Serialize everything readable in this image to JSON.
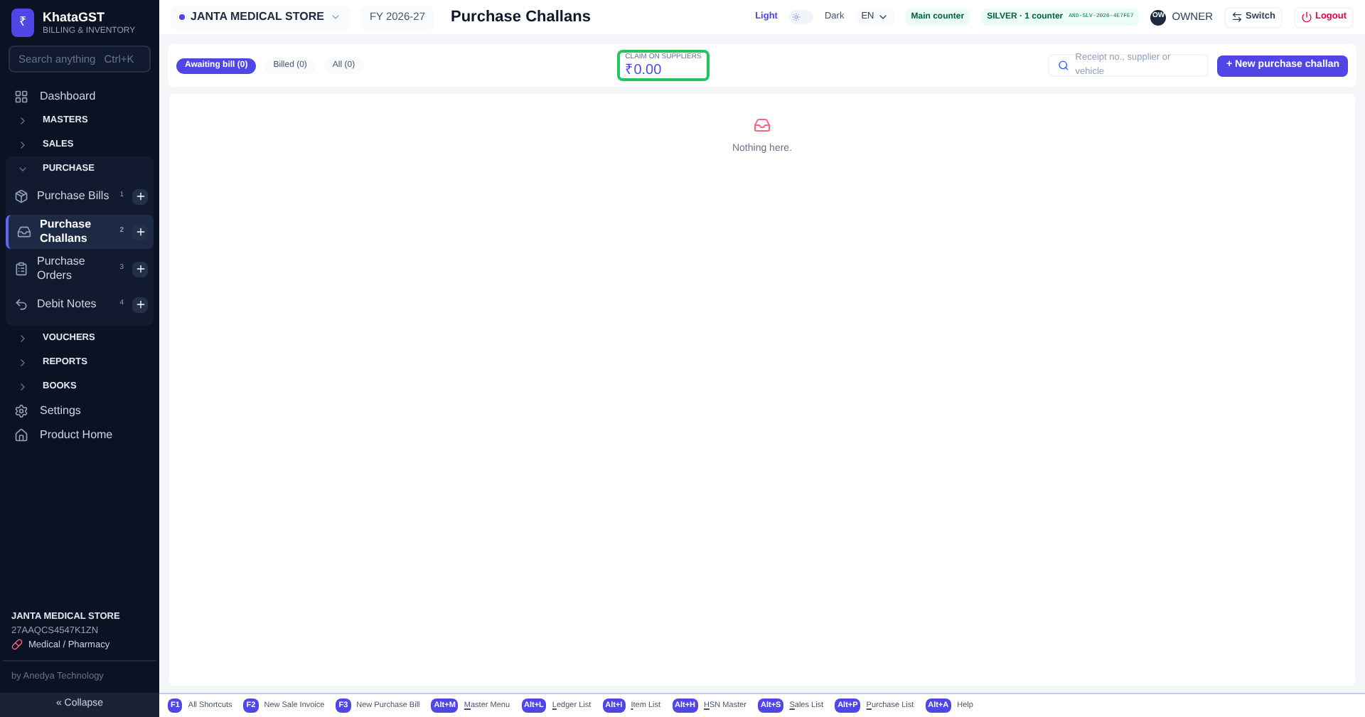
{
  "brand": {
    "logo": "₹",
    "name": "KhataGST",
    "tagline": "BILLING & INVENTORY"
  },
  "search": {
    "placeholder": "Search anything",
    "shortcut": "Ctrl+K"
  },
  "nav": [
    {
      "kind": "link",
      "label": "Dashboard",
      "selected": false
    },
    {
      "kind": "section",
      "label": "MASTERS",
      "expanded": false
    },
    {
      "kind": "section",
      "label": "SALES",
      "expanded": false
    },
    {
      "kind": "section",
      "label": "PURCHASE",
      "expanded": true,
      "children": [
        {
          "label": "Purchase Bills",
          "count": "1",
          "selected": false
        },
        {
          "label": "Purchase Challans",
          "count": "2",
          "selected": true
        },
        {
          "label": "Purchase Orders",
          "count": "3",
          "selected": false
        },
        {
          "label": "Debit Notes",
          "count": "4",
          "selected": false
        }
      ]
    },
    {
      "kind": "section",
      "label": "VOUCHERS",
      "expanded": false
    },
    {
      "kind": "section",
      "label": "REPORTS",
      "expanded": false
    },
    {
      "kind": "section",
      "label": "BOOKS",
      "expanded": false
    },
    {
      "kind": "link",
      "label": "Settings",
      "selected": false
    },
    {
      "kind": "link",
      "label": "Product Home",
      "selected": false
    }
  ],
  "company": {
    "name": "JANTA MEDICAL STORE",
    "gstin": "27AAQCS4547K1ZN",
    "category": "Medical / Pharmacy"
  },
  "credit": "by Anedya Technology",
  "collapse": "« Collapse",
  "topbar": {
    "store": "JANTA MEDICAL STORE",
    "fy": "FY 2026-27",
    "title": "Purchase Challans",
    "light": "Light",
    "dark": "Dark",
    "theme_dark": false,
    "lang": "EN",
    "counter": "Main counter",
    "plan": "SILVER · 1 counter",
    "license": "AND-SLV-2026-4E7FE7",
    "avatar": "OW",
    "role": "OWNER",
    "switch": "Switch",
    "logout": "Logout"
  },
  "filters": [
    {
      "label": "Awaiting bill (0)",
      "selected": true
    },
    {
      "label": "Billed (0)",
      "selected": false
    },
    {
      "label": "All (0)",
      "selected": false
    }
  ],
  "claim": {
    "label": "CLAIM ON SUPPLIERS",
    "value": "₹0.00"
  },
  "list_search": {
    "placeholder": "Receipt no., supplier or vehicle"
  },
  "new_button": "+ New purchase challan",
  "empty": "Nothing here.",
  "shortcuts": [
    {
      "key": "F1",
      "label": "All Shortcuts",
      "underline_first": false
    },
    {
      "key": "F2",
      "label": "New Sale Invoice",
      "underline_first": false
    },
    {
      "key": "F3",
      "label": "New Purchase Bill",
      "underline_first": false
    },
    {
      "key": "Alt+M",
      "label": "Master Menu",
      "underline_first": true
    },
    {
      "key": "Alt+L",
      "label": "Ledger List",
      "underline_first": true
    },
    {
      "key": "Alt+I",
      "label": "Item List",
      "underline_first": true
    },
    {
      "key": "Alt+H",
      "label": "HSN Master",
      "underline_first": true
    },
    {
      "key": "Alt+S",
      "label": "Sales List",
      "underline_first": true
    },
    {
      "key": "Alt+P",
      "label": "Purchase List",
      "underline_first": true
    },
    {
      "key": "Alt+A",
      "label": "Help",
      "underline_first": false
    }
  ]
}
